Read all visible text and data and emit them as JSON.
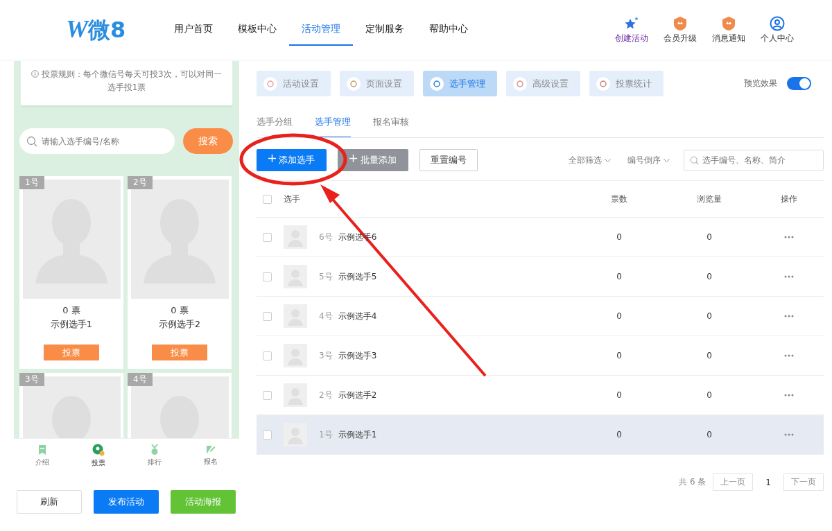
{
  "header": {
    "logo_mark": "W",
    "logo_text": "微8",
    "nav": [
      {
        "label": "用户首页",
        "selected": false
      },
      {
        "label": "模板中心",
        "selected": false
      },
      {
        "label": "活动管理",
        "selected": true
      },
      {
        "label": "定制服务",
        "selected": false
      },
      {
        "label": "帮助中心",
        "selected": false
      }
    ],
    "actions": [
      {
        "kind": "create",
        "label": "创建活动"
      },
      {
        "kind": "upgrade",
        "label": "会员升级"
      },
      {
        "kind": "notify",
        "label": "消息通知"
      },
      {
        "kind": "user",
        "label": "个人中心"
      }
    ]
  },
  "preview": {
    "rules": "投票规则：每个微信号每天可投3次，可以对同一选手投1票",
    "search": {
      "placeholder": "请输入选手编号/名称",
      "button": "搜索"
    },
    "cards": [
      {
        "number": "1号",
        "votes": "0 票",
        "name": "示例选手1",
        "button": "投票"
      },
      {
        "number": "2号",
        "votes": "0 票",
        "name": "示例选手2",
        "button": "投票"
      },
      {
        "number": "3号"
      },
      {
        "number": "4号"
      }
    ],
    "bottom_nav": [
      {
        "kind": "intro",
        "label": "介绍",
        "selected": false
      },
      {
        "kind": "vote",
        "label": "投票",
        "selected": true
      },
      {
        "kind": "rank",
        "label": "排行",
        "selected": false
      },
      {
        "kind": "signup",
        "label": "报名",
        "selected": false
      }
    ],
    "buttons": [
      {
        "kind": "plain",
        "label": "刷新"
      },
      {
        "kind": "primary",
        "label": "发布活动"
      },
      {
        "kind": "success",
        "label": "活动海报"
      }
    ]
  },
  "tabs": [
    {
      "kind": "heart",
      "label": "活动设置",
      "selected": false
    },
    {
      "kind": "page",
      "label": "页面设置",
      "selected": false
    },
    {
      "kind": "person",
      "label": "选手管理",
      "selected": true
    },
    {
      "kind": "advanced",
      "label": "高级设置",
      "selected": false
    },
    {
      "kind": "stats",
      "label": "投票统计",
      "selected": false
    }
  ],
  "preview_toggle": {
    "label": "预览效果",
    "on": true
  },
  "subtabs": [
    {
      "label": "选手分组",
      "selected": false
    },
    {
      "label": "选手管理",
      "selected": true
    },
    {
      "label": "报名审核",
      "selected": false
    }
  ],
  "toolbar": {
    "add": "添加选手",
    "batch": "批量添加",
    "reset": "重置编号",
    "filter": "全部筛选",
    "sort": "编号倒序",
    "search_placeholder": "选手编号、名称、简介"
  },
  "table": {
    "select_all": false,
    "columns": [
      "选手",
      "票数",
      "浏览量",
      "操作"
    ],
    "rows": [
      {
        "number": "6号",
        "name": "示例选手6",
        "votes": "0",
        "views": "0",
        "checked": false,
        "hovered": false
      },
      {
        "number": "5号",
        "name": "示例选手5",
        "votes": "0",
        "views": "0",
        "checked": false,
        "hovered": false
      },
      {
        "number": "4号",
        "name": "示例选手4",
        "votes": "0",
        "views": "0",
        "checked": false,
        "hovered": false
      },
      {
        "number": "3号",
        "name": "示例选手3",
        "votes": "0",
        "views": "0",
        "checked": false,
        "hovered": false
      },
      {
        "number": "2号",
        "name": "示例选手2",
        "votes": "0",
        "views": "0",
        "checked": false,
        "hovered": false
      },
      {
        "number": "1号",
        "name": "示例选手1",
        "votes": "0",
        "views": "0",
        "checked": false,
        "hovered": true
      }
    ]
  },
  "pagination": {
    "total": "共 6 条",
    "prev": "上一页",
    "page": "1",
    "next": "下一页"
  }
}
